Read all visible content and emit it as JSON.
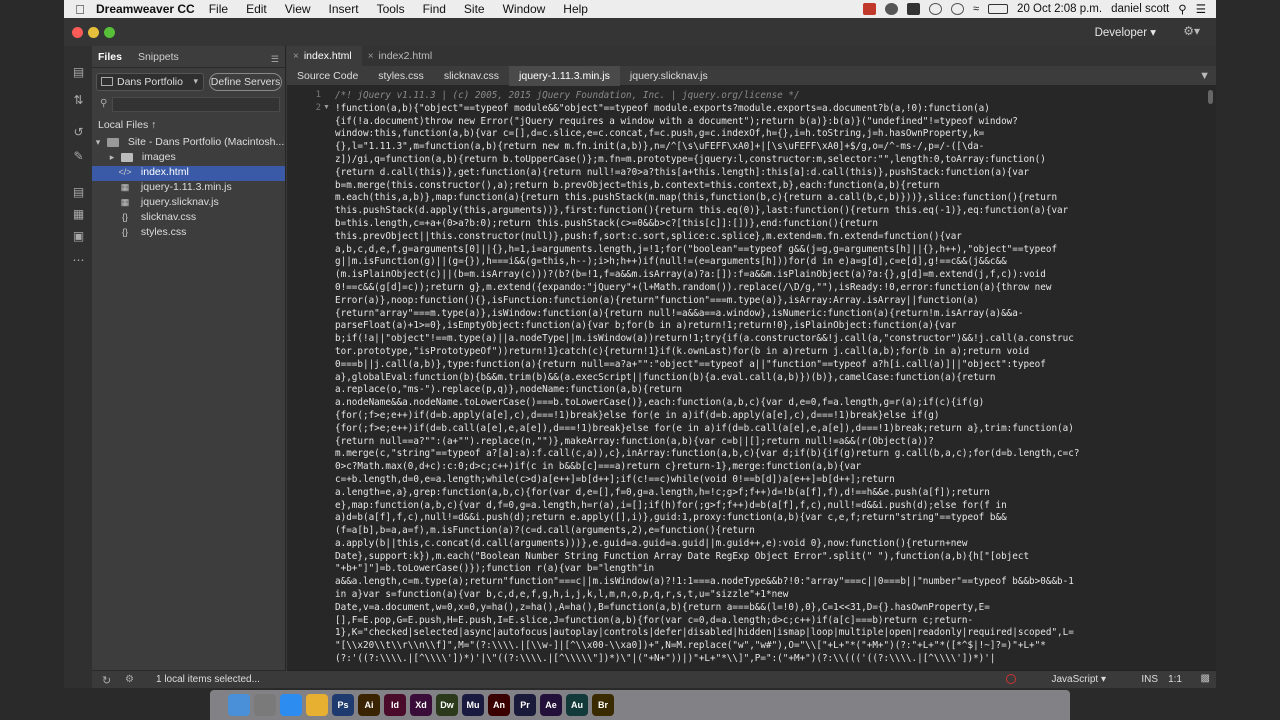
{
  "menubar": {
    "app_name": "Dreamweaver CC",
    "menus": [
      "File",
      "Edit",
      "View",
      "Insert",
      "Tools",
      "Find",
      "Site",
      "Window",
      "Help"
    ],
    "date_time": "20 Oct 2:08 p.m.",
    "user": "daniel scott"
  },
  "window": {
    "workspace": "Developer"
  },
  "files_panel": {
    "tabs": [
      "Files",
      "Snippets"
    ],
    "site_name": "Dans Portfolio",
    "define_servers": "Define Servers",
    "local_files_label": "Local Files ↑",
    "site_root": "Site - Dans Portfolio (Macintosh...",
    "items": [
      {
        "name": "images",
        "type": "folder"
      },
      {
        "name": "index.html",
        "type": "html"
      },
      {
        "name": "jquery-1.11.3.min.js",
        "type": "js"
      },
      {
        "name": "jquery.slicknav.js",
        "type": "js"
      },
      {
        "name": "slicknav.css",
        "type": "css"
      },
      {
        "name": "styles.css",
        "type": "css"
      }
    ],
    "status": "1 local items selected..."
  },
  "document_tabs": [
    "index.html",
    "index2.html"
  ],
  "related_files": [
    "Source Code",
    "styles.css",
    "slicknav.css",
    "jquery-1.11.3.min.js",
    "jquery.slicknav.js"
  ],
  "editor": {
    "line_numbers": [
      "1",
      "2"
    ],
    "code_lines": [
      "/*! jQuery v1.11.3 | (c) 2005, 2015 jQuery Foundation, Inc. | jquery.org/license */",
      "!function(a,b){\"object\"==typeof module&&\"object\"==typeof module.exports?module.exports=a.document?b(a,!0):function(a)",
      "{if(!a.document)throw new Error(\"jQuery requires a window with a document\");return b(a)}:b(a)}(\"undefined\"!=typeof window?",
      "window:this,function(a,b){var c=[],d=c.slice,e=c.concat,f=c.push,g=c.indexOf,h={},i=h.toString,j=h.hasOwnProperty,k=",
      "{},l=\"1.11.3\",m=function(a,b){return new m.fn.init(a,b)},n=/^[\\s\\uFEFF\\xA0]+|[\\s\\uFEFF\\xA0]+$/g,o=/^-ms-/,p=/-([\\da-",
      "z])/gi,q=function(a,b){return b.toUpperCase()};m.fn=m.prototype={jquery:l,constructor:m,selector:\"\",length:0,toArray:function()",
      "{return d.call(this)},get:function(a){return null!=a?0>a?this[a+this.length]:this[a]:d.call(this)},pushStack:function(a){var",
      "b=m.merge(this.constructor(),a);return b.prevObject=this,b.context=this.context,b},each:function(a,b){return",
      "m.each(this,a,b)},map:function(a){return this.pushStack(m.map(this,function(b,c){return a.call(b,c,b)}))},slice:function(){return",
      "this.pushStack(d.apply(this,arguments))},first:function(){return this.eq(0)},last:function(){return this.eq(-1)},eq:function(a){var",
      "b=this.length,c=+a+(0>a?b:0);return this.pushStack(c>=0&&b>c?[this[c]]:[])},end:function(){return",
      "this.prevObject||this.constructor(null)},push:f,sort:c.sort,splice:c.splice},m.extend=m.fn.extend=function(){var",
      "a,b,c,d,e,f,g=arguments[0]||{},h=1,i=arguments.length,j=!1;for(\"boolean\"==typeof g&&(j=g,g=arguments[h]||{},h++),\"object\"==typeof",
      "g||m.isFunction(g)||(g={}),h===i&&(g=this,h--);i>h;h++)if(null!=(e=arguments[h]))for(d in e)a=g[d],c=e[d],g!==c&&(j&&c&&",
      "(m.isPlainObject(c)||(b=m.isArray(c)))?(b?(b=!1,f=a&&m.isArray(a)?a:[]):f=a&&m.isPlainObject(a)?a:{},g[d]=m.extend(j,f,c)):void",
      "0!==c&&(g[d]=c));return g},m.extend({expando:\"jQuery\"+(l+Math.random()).replace(/\\D/g,\"\"),isReady:!0,error:function(a){throw new",
      "Error(a)},noop:function(){},isFunction:function(a){return\"function\"===m.type(a)},isArray:Array.isArray||function(a)",
      "{return\"array\"===m.type(a)},isWindow:function(a){return null!=a&&a==a.window},isNumeric:function(a){return!m.isArray(a)&&a-",
      "parseFloat(a)+1>=0},isEmptyObject:function(a){var b;for(b in a)return!1;return!0},isPlainObject:function(a){var",
      "b;if(!a||\"object\"!==m.type(a)||a.nodeType||m.isWindow(a))return!1;try{if(a.constructor&&!j.call(a,\"constructor\")&&!j.call(a.construc",
      "tor.prototype,\"isPrototypeOf\"))return!1}catch(c){return!1}if(k.ownLast)for(b in a)return j.call(a,b);for(b in a);return void",
      "0===b||j.call(a,b)},type:function(a){return null==a?a+\"\":\"object\"==typeof a||\"function\"==typeof a?h[i.call(a)]||\"object\":typeof",
      "a},globalEval:function(b){b&&m.trim(b)&&(a.execScript||function(b){a.eval.call(a,b)})(b)},camelCase:function(a){return",
      "a.replace(o,\"ms-\").replace(p,q)},nodeName:function(a,b){return",
      "a.nodeName&&a.nodeName.toLowerCase()===b.toLowerCase()},each:function(a,b,c){var d,e=0,f=a.length,g=r(a);if(c){if(g)",
      "{for(;f>e;e++)if(d=b.apply(a[e],c),d===!1)break}else for(e in a)if(d=b.apply(a[e],c),d===!1)break}else if(g)",
      "{for(;f>e;e++)if(d=b.call(a[e],e,a[e]),d===!1)break}else for(e in a)if(d=b.call(a[e],e,a[e]),d===!1)break;return a},trim:function(a)",
      "{return null==a?\"\":(a+\"\").replace(n,\"\")},makeArray:function(a,b){var c=b||[];return null!=a&&(r(Object(a))?",
      "m.merge(c,\"string\"==typeof a?[a]:a):f.call(c,a)),c},inArray:function(a,b,c){var d;if(b){if(g)return g.call(b,a,c);for(d=b.length,c=c?",
      "0>c?Math.max(0,d+c):c:0;d>c;c++)if(c in b&&b[c]===a)return c}return-1},merge:function(a,b){var",
      "c=+b.length,d=0,e=a.length;while(c>d)a[e++]=b[d++];if(c!==c)while(void 0!==b[d])a[e++]=b[d++];return",
      "a.length=e,a},grep:function(a,b,c){for(var d,e=[],f=0,g=a.length,h=!c;g>f;f++)d=!b(a[f],f),d!==h&&e.push(a[f]);return",
      "e},map:function(a,b,c){var d,f=0,g=a.length,h=r(a),i=[];if(h)for(;g>f;f++)d=b(a[f],f,c),null!=d&&i.push(d);else for(f in",
      "a)d=b(a[f],f,c),null!=d&&i.push(d);return e.apply([],i)},guid:1,proxy:function(a,b){var c,e,f;return\"string\"==typeof b&&",
      "(f=a[b],b=a,a=f),m.isFunction(a)?(c=d.call(arguments,2),e=function(){return",
      "a.apply(b||this,c.concat(d.call(arguments)))},e.guid=a.guid=a.guid||m.guid++,e):void 0},now:function(){return+new",
      "Date},support:k}),m.each(\"Boolean Number String Function Array Date RegExp Object Error\".split(\" \"),function(a,b){h[\"[object",
      "\"+b+\"]\"]=b.toLowerCase()});function r(a){var b=\"length\"in",
      "a&&a.length,c=m.type(a);return\"function\"===c||m.isWindow(a)?!1:1===a.nodeType&&b?!0:\"array\"===c||0===b||\"number\"==typeof b&&b>0&&b-1",
      "in a}var s=function(a){var b,c,d,e,f,g,h,i,j,k,l,m,n,o,p,q,r,s,t,u=\"sizzle\"+1*new",
      "Date,v=a.document,w=0,x=0,y=ha(),z=ha(),A=ha(),B=function(a,b){return a===b&&(l=!0),0},C=1<<31,D={}.hasOwnProperty,E=",
      "[],F=E.pop,G=E.push,H=E.push,I=E.slice,J=function(a,b){for(var c=0,d=a.length;d>c;c++)if(a[c]===b)return c;return-",
      "1},K=\"checked|selected|async|autofocus|autoplay|controls|defer|disabled|hidden|ismap|loop|multiple|open|readonly|required|scoped\",L=",
      "\"[\\\\x20\\\\t\\\\r\\\\n\\\\f]\",M=\"(?:\\\\\\\\.|[\\\\w-]|[^\\\\x00-\\\\xa0])+\",N=M.replace(\"w\",\"w#\"),O=\"\\\\[\"+L+\"*(\"+M+\")(?:\"+L+\"*([*^$|!~]?=)\"+L+\"*",
      "(?:'((?:\\\\\\\\.|[^\\\\\\\\'])*)'|\\\"((?:\\\\\\\\.|[^\\\\\\\\\\\"])*)\\\"|(\"+N+\"))|)\"+L+\"*\\\\]\",P=\":(\"+M+\")(?:\\\\((('((?:\\\\\\\\.|[^\\\\\\\\'])*)'|"
    ]
  },
  "statusbar": {
    "language": "JavaScript",
    "mode": "INS",
    "position": "1:1"
  },
  "dock": {
    "apps": [
      "Finder",
      "Launchpad",
      "Safari",
      "Chrome",
      "Ps",
      "Ai",
      "Id",
      "Xd",
      "Dw",
      "Mu",
      "An",
      "Pr",
      "Ae",
      "Au",
      "Br"
    ]
  }
}
